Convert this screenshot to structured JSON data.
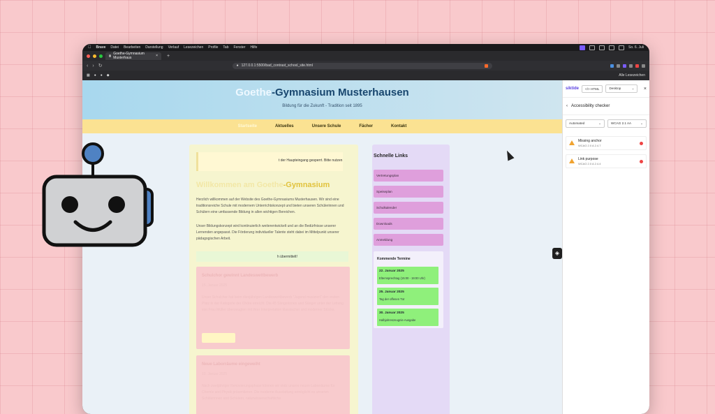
{
  "menubar": {
    "app": "Brave",
    "items": [
      "Datei",
      "Bearbeiten",
      "Darstellung",
      "Verlauf",
      "Lesezeichen",
      "Profile",
      "Tab",
      "Fenster",
      "Hilfe"
    ],
    "clock": "So. 6. Juli"
  },
  "tab": {
    "title": "Goethe-Gymnasium Musterhaus"
  },
  "address": {
    "url": "127.0.0.1:5500/bad_contrast_school_site.html"
  },
  "bookmarks": {
    "all": "Alle Lesezeichen"
  },
  "site": {
    "title_light": "Goethe",
    "title_rest": "-Gymnasium Musterhausen",
    "subtitle": "Bildung für die Zukunft - Tradition seit 1895",
    "nav": [
      "Startseite",
      "Aktuelles",
      "Unsere Schule",
      "Fächer",
      "Kontakt"
    ],
    "notice": "t der Haupteingang gesperrt. Bitte nutzen",
    "welcome_light": "Willkommen am Goethe",
    "welcome_rest": "-Gymnasium",
    "p1": "Herzlich willkommen auf der Website des Goethe-Gymnasiums Musterhausen. Wir sind eine traditionsreiche Schule mit modernem Unterrichtskonzept und bieten unseren Schülerinnen und Schülern eine umfassende Bildung in allen wichtigen Bereichen.",
    "p2": "Unser Bildungskonzept wird kontinuierlich weiterentwickelt und an die Bedürfnisse unserer Lernenden angepasst. Die Förderung individueller Talente steht dabei im Mittelpunkt unserer pädagogischen Arbeit.",
    "success": "h übermittelt!",
    "news1": {
      "title": "Schulchor gewinnt Landeswettbewerb",
      "date": "15. Januar 2025",
      "text": "Unser Schulchor hat beim diesjährigen Landeswettbewerb \"Jugend musiziert\" den ersten Platz in der Kategorie der Chöre erreicht. Die 45 Sängerinnen und Sänger unter der Leitung von Frau Müller überzeugten mit ihrer Interpretation klassischer und moderner Stücke.",
      "more": "Weiterlesen"
    },
    "news2": {
      "title": "Neue Laborräume eingeweiht",
      "date": "10. Januar 2025",
      "text": "Nach zweijähriger Renovierungsphase können wir stolz unsere neuen Laborräume für Chemie und Physik präsentieren. Die moderne Ausstattung ermöglicht es unseren Schülerinnen und Schülern, naturwissenschaftliche"
    },
    "sidebar": {
      "title": "Schnelle Links",
      "links": [
        "Vertretungsplan",
        "Speiseplan",
        "Schulkalender",
        "Downloads",
        "Anmeldung"
      ],
      "events_title": "Kommende Termine",
      "events": [
        {
          "date": "22. Januar 2025",
          "text": "Elternsprechtag (15:00 - 19:00 Uhr)"
        },
        {
          "date": "25. Januar 2025",
          "text": "Tag der offenen Tür"
        },
        {
          "date": "30. Januar 2025",
          "text": "Halbjahreszeugnis-Ausgabe"
        }
      ]
    }
  },
  "panel": {
    "logo": "siktide",
    "html_btn": "HTML",
    "device": "Desktop",
    "heading": "Accessibility checker",
    "mode": "Automated",
    "standard": "WCAG 2.1 AA",
    "issues": [
      {
        "title": "Missing anchor",
        "ref": "WCAG 2.0 A 2.4.7"
      },
      {
        "title": "Link purpose",
        "ref": "WCAG 2.0 A 2.4.4"
      }
    ]
  }
}
